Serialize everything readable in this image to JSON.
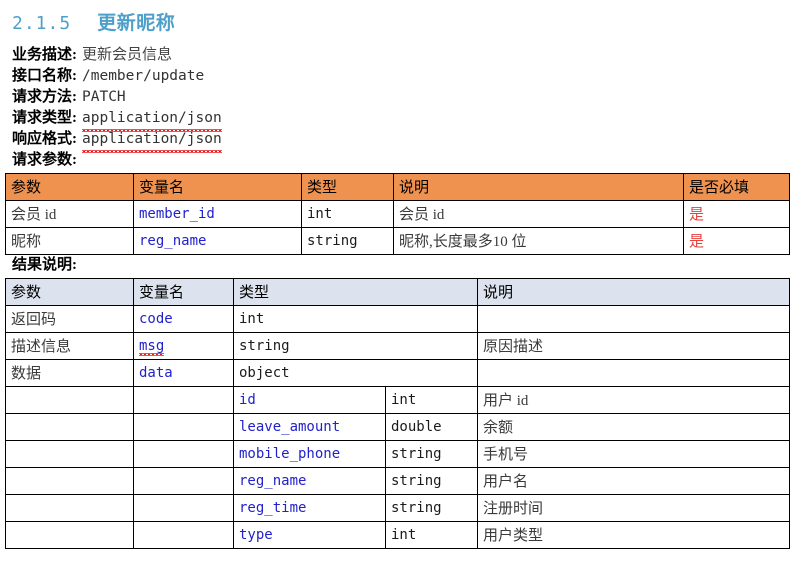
{
  "heading": {
    "number": "2.1.5",
    "title": "更新昵称",
    "color": "#4FA0C8"
  },
  "meta": {
    "rows": [
      {
        "label": "业务描述:",
        "value": "更新会员信息",
        "is_cjk": true,
        "squiggle": false
      },
      {
        "label": "接口名称:",
        "value": "/member/update",
        "is_cjk": false,
        "squiggle": false
      },
      {
        "label": "请求方法:",
        "value": "PATCH",
        "is_cjk": false,
        "squiggle": false
      },
      {
        "label": "请求类型:",
        "value": "application/json",
        "is_cjk": false,
        "squiggle": true
      },
      {
        "label": "响应格式:",
        "value": "application/json",
        "is_cjk": false,
        "squiggle": true
      }
    ]
  },
  "request_section": {
    "label": "请求参数:",
    "header_color": "#F0924F",
    "headers": [
      "参数",
      "变量名",
      "类型",
      "说明",
      "是否必填"
    ],
    "rows": [
      {
        "param": "会员 id",
        "variable": "member_id",
        "type": "int",
        "desc": "会员 id",
        "required": "是"
      },
      {
        "param": "昵称",
        "variable": "reg_name",
        "type": "string",
        "desc": "昵称,长度最多10 位",
        "required": "是"
      }
    ]
  },
  "result_section": {
    "label": "结果说明:",
    "header_color": "#DCE3EE",
    "headers": [
      "参数",
      "变量名",
      "类型",
      "说明"
    ],
    "rows": [
      {
        "param": "返回码",
        "variable": "code",
        "variable_squiggle": false,
        "type": "int",
        "desc": ""
      },
      {
        "param": "描述信息",
        "variable": "msg",
        "variable_squiggle": true,
        "type": "string",
        "desc": "原因描述"
      },
      {
        "param": "数据",
        "variable": "data",
        "variable_squiggle": false,
        "type": "object",
        "desc": ""
      }
    ],
    "nested_rows": [
      {
        "field": "id",
        "type": "int",
        "desc": "用户 id"
      },
      {
        "field": "leave_amount",
        "type": "double",
        "desc": "余额"
      },
      {
        "field": "mobile_phone",
        "type": "string",
        "desc": "手机号"
      },
      {
        "field": "reg_name",
        "type": "string",
        "desc": "用户名"
      },
      {
        "field": "reg_time",
        "type": "string",
        "desc": "注册时间"
      },
      {
        "field": "type",
        "type": "int",
        "desc": "用户类型"
      }
    ]
  }
}
